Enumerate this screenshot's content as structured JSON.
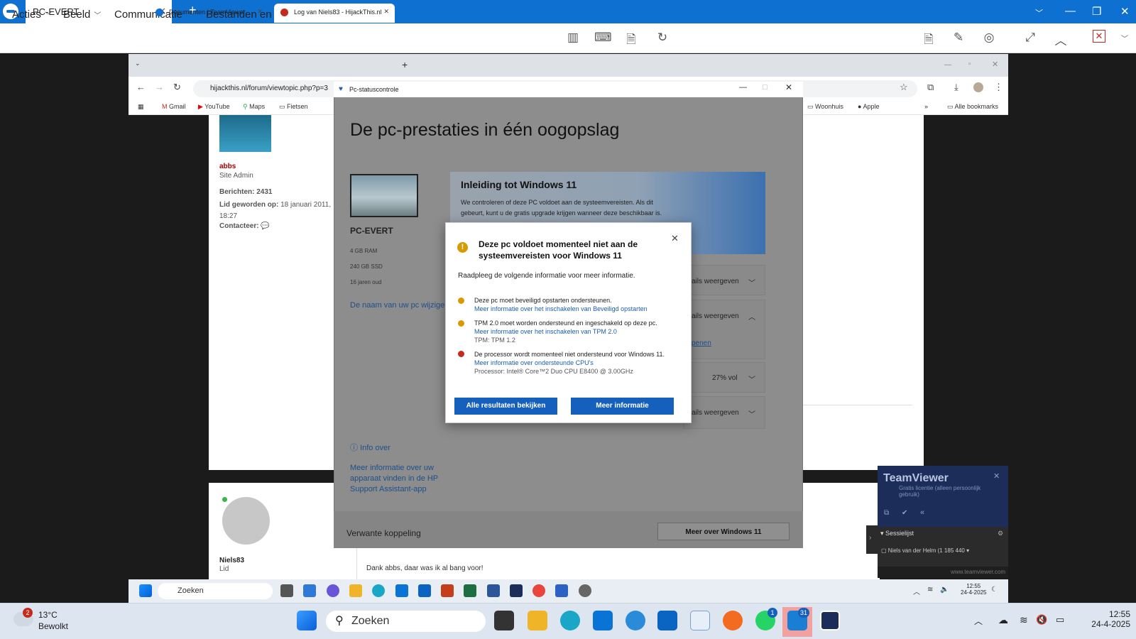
{
  "tv": {
    "tab_title": "PC-EVERT",
    "menu": [
      "Acties",
      "Beeld",
      "Communicatie",
      "Bestanden en extra's"
    ]
  },
  "chrome": {
    "tab1": "Documenten | TeamViewer",
    "tab2": "Log van Niels83 - HijackThis.nl",
    "url": "hijackthis.nl/forum/viewtopic.php?p=3",
    "bookmarks": [
      "Gmail",
      "YouTube",
      "Maps",
      "Fietsen",
      "Woonhuis",
      "Apple",
      "Alle bookmarks"
    ]
  },
  "forum": {
    "user1": "abbs",
    "role1": "Site Admin",
    "posts_label": "Berichten:",
    "posts": "2431",
    "member_label": "Lid geworden op:",
    "member_since": "18 januari 2011, 18:27",
    "contact": "Contacteer:",
    "user2": "Niels83",
    "role2": "Lid",
    "reply": "Dank abbs, daar was ik al bang voor!"
  },
  "pc": {
    "window_title": "Pc-statuscontrole",
    "heading": "De pc-prestaties in één oogopslag",
    "pc_name": "PC-EVERT",
    "ram": "4 GB RAM",
    "ssd": "240 GB SSD",
    "age": "16 jaren oud",
    "rename": "De naam van uw pc wijzige",
    "card_title": "Inleiding tot Windows 11",
    "card_text": "We controleren of deze PC voldoet aan de systeemvereisten. Als dit gebeurt, kunt u de gratis upgrade krijgen wanneer deze beschikbaar is.",
    "row1": "ails weergeven",
    "row2": "ails weergeven",
    "row2_link": "penen",
    "row3": "27% vol",
    "row4": "ails weergeven",
    "info_over": "Info over",
    "hp_link": "Meer informatie over uw apparaat vinden in de HP Support Assistant-app",
    "related": "Verwante koppeling",
    "more_win11": "Meer over Windows 11"
  },
  "modal": {
    "title": "Deze pc voldoet momenteel niet aan de systeemvereisten voor Windows 11",
    "subtitle": "Raadpleeg de volgende informatie voor meer informatie.",
    "item1": "Deze pc moet beveiligd opstarten ondersteunen.",
    "item1_link": "Meer informatie over het inschakelen van Beveiligd opstarten",
    "item2": "TPM 2.0 moet worden ondersteund en ingeschakeld op deze pc.",
    "item2_link": "Meer informatie over het inschakelen van TPM 2.0",
    "item2_extra": "TPM: TPM 1.2",
    "item3": "De processor wordt momenteel niet ondersteund voor Windows 11.",
    "item3_link": "Meer informatie over ondersteunde CPU's",
    "item3_extra": "Processor: Intel® Core™2 Duo CPU E8400 @ 3.00GHz",
    "btn1": "Alle resultaten bekijken",
    "btn2": "Meer informatie"
  },
  "tvpanel": {
    "brand": "TeamViewer",
    "license": "Gratis licentie (alleen persoonlijk gebruik)",
    "sessions": "Sessielijst",
    "session_item": "Niels van der Helm (1 185 440",
    "site": "www.teamviewer.com"
  },
  "itask": {
    "search": "Zoeken",
    "time": "12:55",
    "date": "24-4-2025"
  },
  "otask": {
    "temp": "13°C",
    "weather": "Bewolkt",
    "search": "Zoeken",
    "time": "12:55",
    "date": "24-4-2025",
    "weather_badge": "2",
    "whatsapp_badge": "1",
    "teams_badge": "31"
  }
}
